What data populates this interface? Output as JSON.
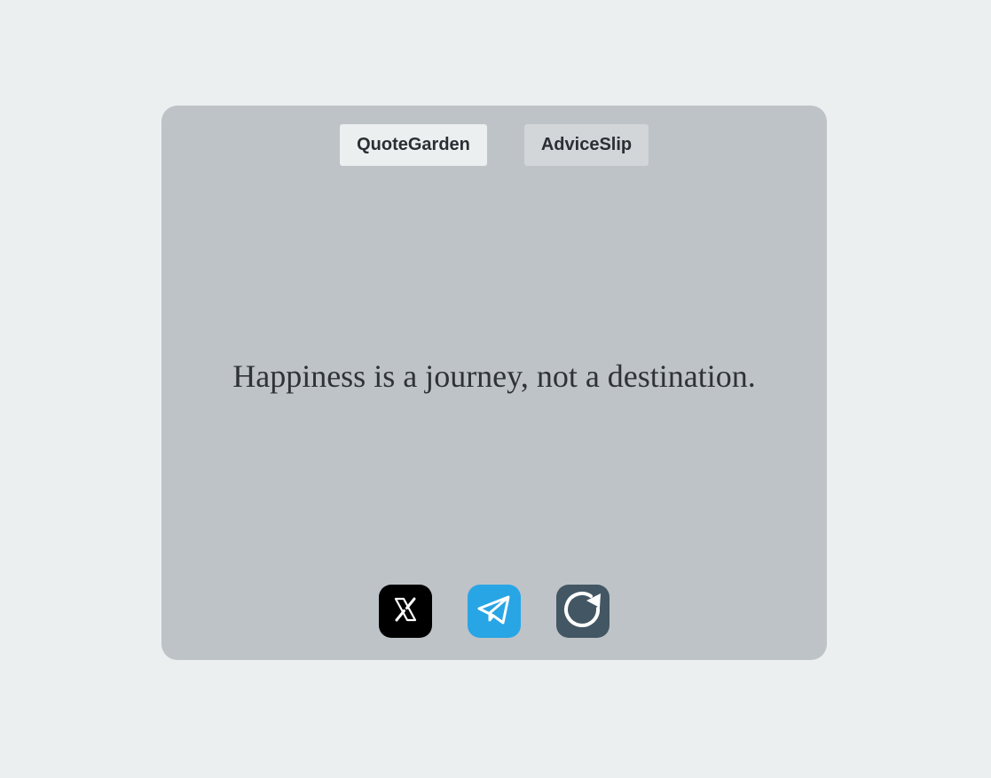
{
  "tabs": [
    {
      "label": "QuoteGarden",
      "active": true
    },
    {
      "label": "AdviceSlip",
      "active": false
    }
  ],
  "quote": {
    "text": "Happiness is a journey, not a destination."
  },
  "actions": [
    {
      "icon": "x-twitter-icon",
      "color": "#000000"
    },
    {
      "icon": "telegram-icon",
      "color": "#28a5e5"
    },
    {
      "icon": "refresh-icon",
      "color": "#435663"
    }
  ],
  "colors": {
    "page_background": "#ebeff0",
    "card_background": "#bec3c7",
    "text": "#2b2f33"
  }
}
